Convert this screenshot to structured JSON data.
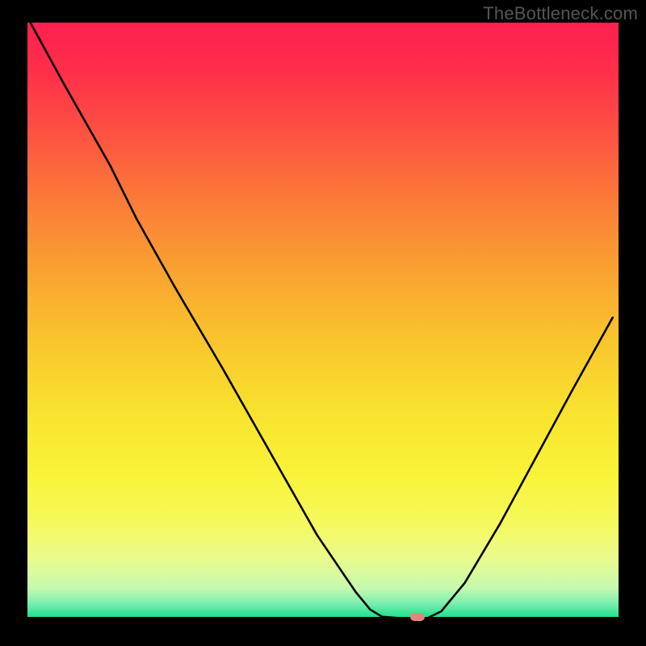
{
  "watermark": "TheBottleneck.com",
  "colors": {
    "background_black": "#000000",
    "marker": "#e8857b",
    "curve": "#000000"
  },
  "chart_data": {
    "type": "line",
    "title": "",
    "x_range_pct": [
      0,
      100
    ],
    "y_range_pct": [
      0,
      100
    ],
    "curve_points_pct": [
      [
        0.5,
        100.0
      ],
      [
        6.0,
        90.0
      ],
      [
        14.0,
        76.0
      ],
      [
        18.5,
        67.0
      ],
      [
        25.0,
        55.5
      ],
      [
        33.0,
        42.0
      ],
      [
        41.0,
        28.0
      ],
      [
        49.0,
        14.0
      ],
      [
        55.5,
        4.5
      ],
      [
        58.0,
        1.5
      ],
      [
        60.0,
        0.3
      ],
      [
        64.0,
        0.0
      ],
      [
        67.5,
        0.0
      ],
      [
        70.0,
        1.2
      ],
      [
        74.0,
        6.0
      ],
      [
        80.0,
        16.0
      ],
      [
        86.0,
        27.0
      ],
      [
        92.0,
        38.0
      ],
      [
        99.0,
        50.5
      ]
    ],
    "minimum_marker_pct": {
      "x": 66.0,
      "y": 0.3
    },
    "gradient_stops": [
      {
        "offset": 0.0,
        "color": "#fe204e"
      },
      {
        "offset": 0.08,
        "color": "#fe2e4a"
      },
      {
        "offset": 0.18,
        "color": "#fd5042"
      },
      {
        "offset": 0.3,
        "color": "#fb7b38"
      },
      {
        "offset": 0.42,
        "color": "#faa331"
      },
      {
        "offset": 0.54,
        "color": "#f9c72d"
      },
      {
        "offset": 0.66,
        "color": "#f9e42f"
      },
      {
        "offset": 0.76,
        "color": "#f9f33a"
      },
      {
        "offset": 0.84,
        "color": "#f6f95d"
      },
      {
        "offset": 0.9,
        "color": "#eafb8e"
      },
      {
        "offset": 0.95,
        "color": "#c4f9af"
      },
      {
        "offset": 0.975,
        "color": "#79eeb0"
      },
      {
        "offset": 1.0,
        "color": "#16de88"
      }
    ],
    "xlabel": "",
    "ylabel": ""
  }
}
